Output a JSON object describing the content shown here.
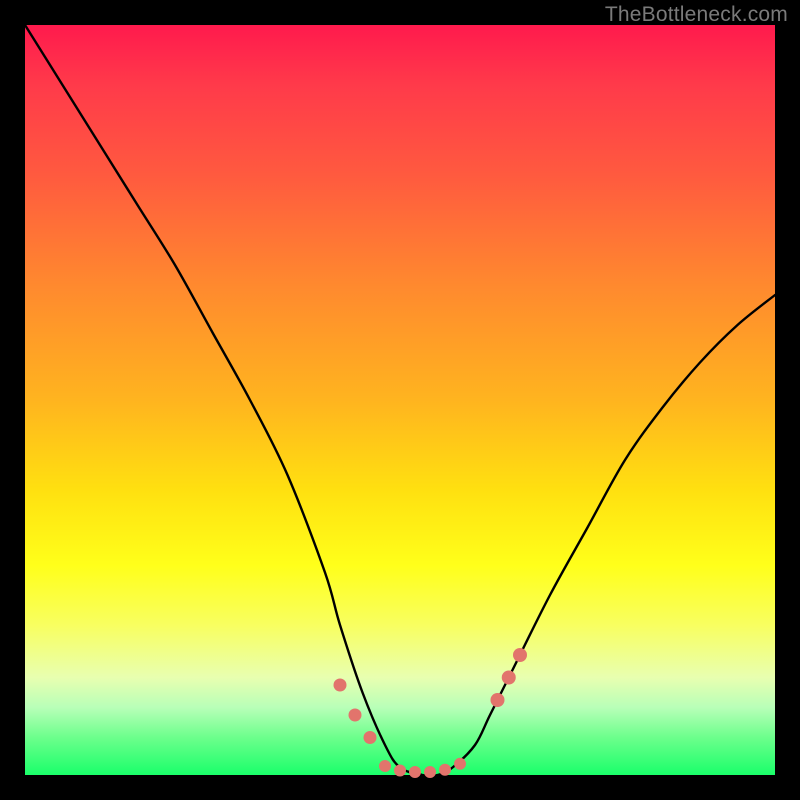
{
  "watermark": "TheBottleneck.com",
  "colors": {
    "frame": "#000000",
    "curve_stroke": "#000000",
    "marker_fill": "#e2746c"
  },
  "chart_data": {
    "type": "line",
    "title": "",
    "xlabel": "",
    "ylabel": "",
    "xlim": [
      0,
      100
    ],
    "ylim": [
      0,
      100
    ],
    "grid": false,
    "legend": false,
    "series": [
      {
        "name": "bottleneck-curve",
        "x": [
          0,
          5,
          10,
          15,
          20,
          25,
          30,
          35,
          40,
          42,
          45,
          48,
          50,
          53,
          55,
          57,
          60,
          62,
          65,
          70,
          75,
          80,
          85,
          90,
          95,
          100
        ],
        "y": [
          100,
          92,
          84,
          76,
          68,
          59,
          50,
          40,
          27,
          20,
          11,
          4,
          1,
          0,
          0,
          1,
          4,
          8,
          14,
          24,
          33,
          42,
          49,
          55,
          60,
          64
        ]
      }
    ],
    "markers": [
      {
        "name": "left-cluster",
        "points": [
          {
            "x": 42,
            "y": 12
          },
          {
            "x": 44,
            "y": 8
          },
          {
            "x": 46,
            "y": 5
          }
        ],
        "size": 9
      },
      {
        "name": "bottom-flat",
        "points": [
          {
            "x": 48,
            "y": 1.2
          },
          {
            "x": 50,
            "y": 0.6
          },
          {
            "x": 52,
            "y": 0.4
          },
          {
            "x": 54,
            "y": 0.4
          },
          {
            "x": 56,
            "y": 0.7
          },
          {
            "x": 58,
            "y": 1.5
          }
        ],
        "size": 8
      },
      {
        "name": "right-cluster",
        "points": [
          {
            "x": 63,
            "y": 10
          },
          {
            "x": 64.5,
            "y": 13
          },
          {
            "x": 66,
            "y": 16
          }
        ],
        "size": 10
      }
    ]
  }
}
